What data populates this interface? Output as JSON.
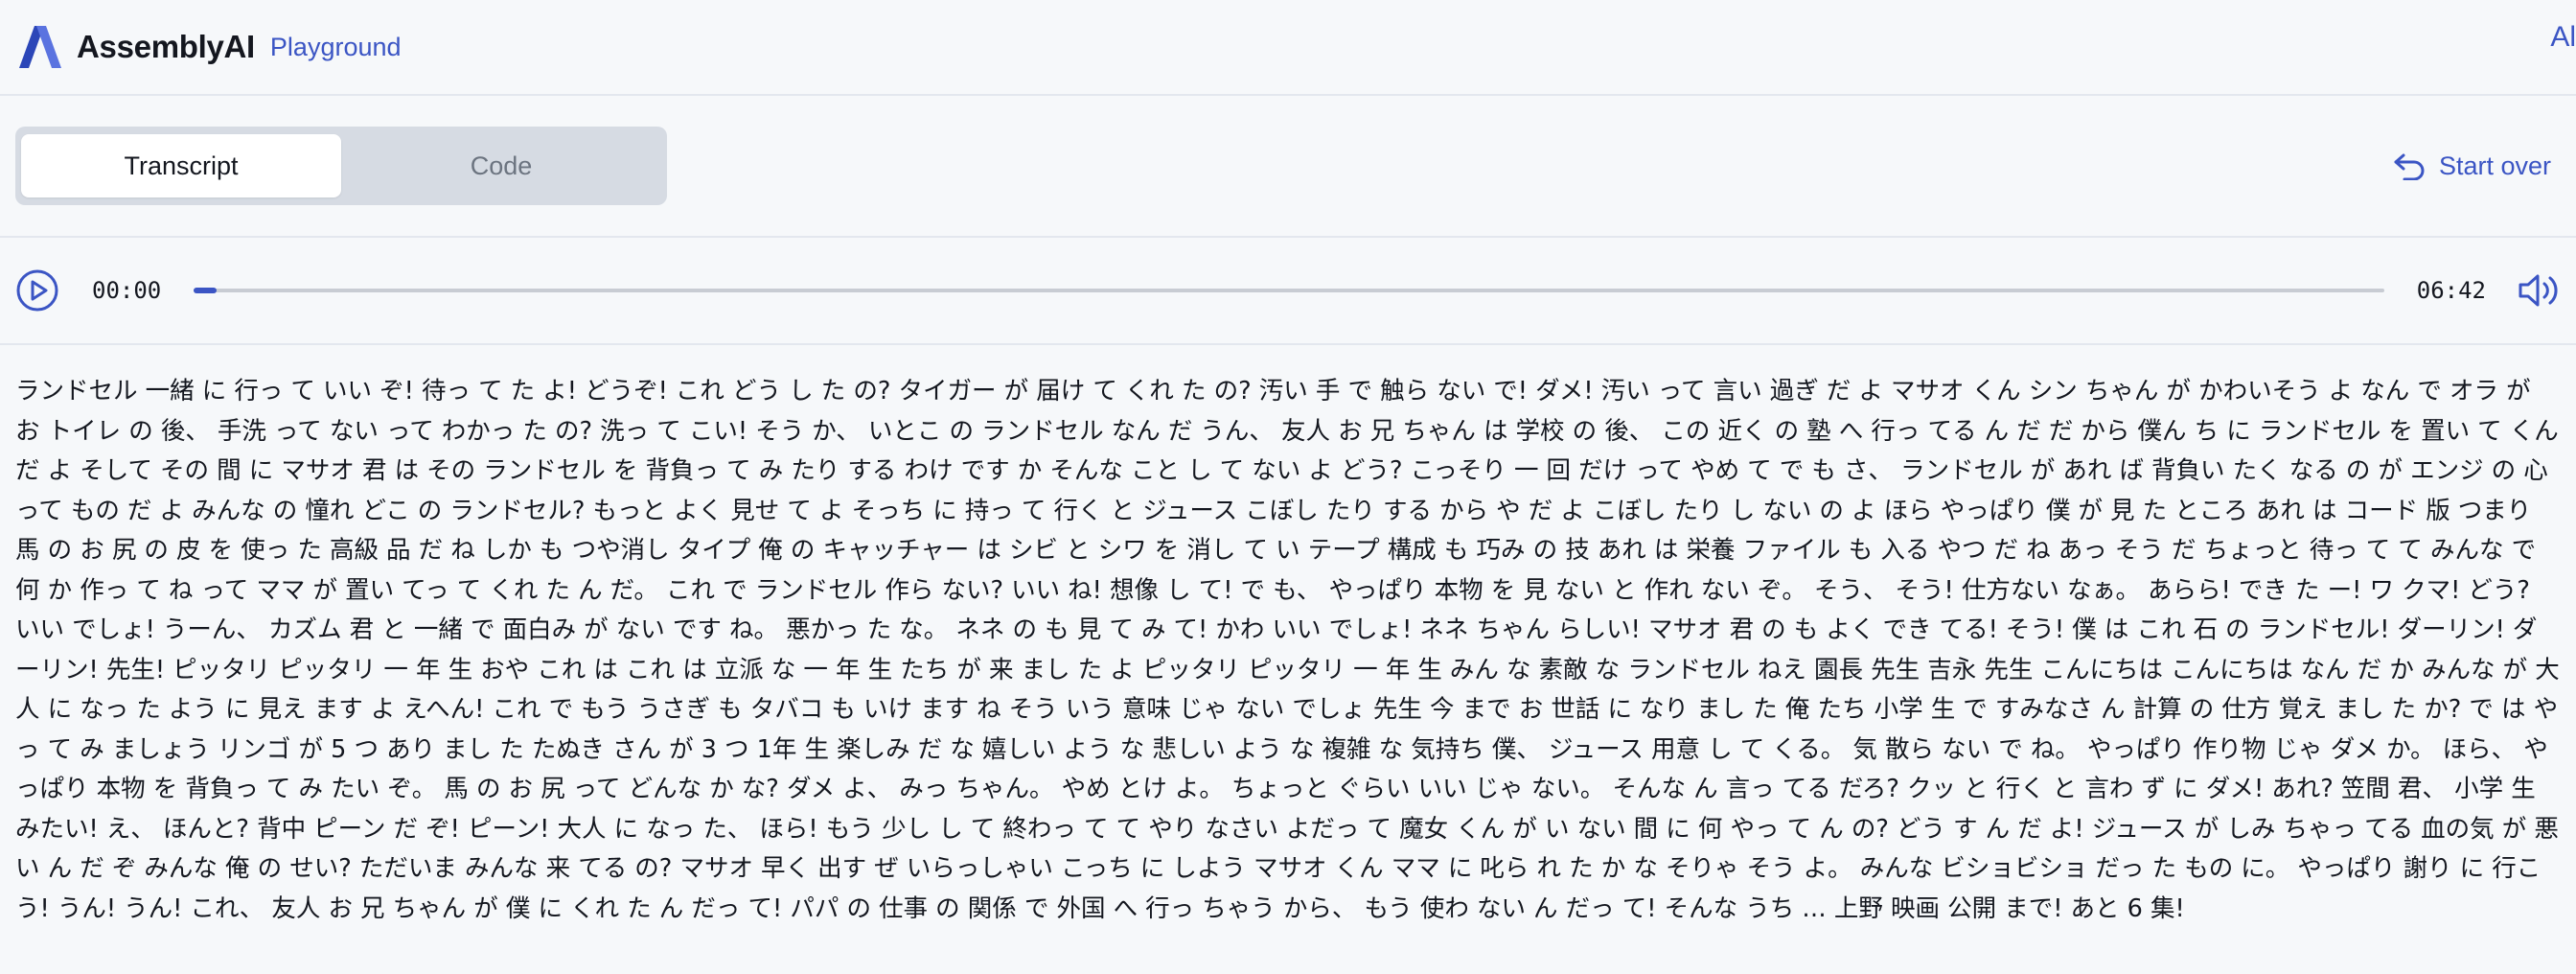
{
  "header": {
    "logo_icon": "assemblyai-logo-icon",
    "brand": "AssemblyAI",
    "product": "Playground",
    "right_partial": "Al"
  },
  "tabs": [
    {
      "label": "Transcript",
      "active": true
    },
    {
      "label": "Code",
      "active": false
    }
  ],
  "start_over": {
    "label": "Start over",
    "icon": "undo-arrow-icon"
  },
  "player": {
    "play_icon": "play-circle-icon",
    "current_time": "00:00",
    "duration": "06:42",
    "progress": 0.0,
    "volume_icon": "volume-icon"
  },
  "colors": {
    "accent": "#3b55c4",
    "background": "#f6f8fa",
    "tab_track": "#d6dbe3"
  },
  "transcript": {
    "text": "ランドセル 一緒 に 行っ て いい ぞ! 待っ て た よ! どうぞ! これ どう し た の? タイガー が 届け て くれ た の? 汚い 手 で 触ら ない で! ダメ! 汚い って 言い 過ぎ だ よ マサオ くん シン ちゃん が かわいそう よ なん で オラ が お トイレ の 後、 手洗 って ない って わかっ た の? 洗っ て こい! そう か、 いとこ の ランドセル なん だ うん、 友人 お 兄 ちゃん は 学校 の 後、 この 近く の 塾 へ 行っ てる ん だ だ から 僕ん ち に ランドセル を 置い て くん だ よ そして その 間 に マサオ 君 は その ランドセル を 背負っ て み たり する わけ です か そんな こと し て ない よ どう? こっそり 一 回 だけ って やめ て で も さ、 ランドセル が あれ ば 背負い たく なる の が エンジ の 心 って もの だ よ みんな の 憧れ どこ の ランドセル? もっと よく 見せ て よ そっち に 持っ て 行く と ジュース こぼし たり する から や だ よ こぼし たり し ない の よ ほら やっぱり 僕 が 見 た ところ あれ は コード 版 つまり 馬 の お 尻 の 皮 を 使っ た 高級 品 だ ね しか も つや消し タイプ 俺 の キャッチャー は シビ と シワ を 消し て い テープ 構成 も 巧み の 技 あれ は 栄養 ファイル も 入る やつ だ ね あっ そう だ ちょっと 待っ て て みんな で 何 か 作っ て ね って ママ が 置い てっ て くれ た ん だ。 これ で ランドセル 作ら ない? いい ね! 想像 し て! で も、 やっぱり 本物 を 見 ない と 作れ ない ぞ。 そう、 そう! 仕方ない なぁ。 あらら! でき た ー! ワ クマ! どう? いい でしょ! うーん、 カズム 君 と 一緒 で 面白み が ない です ね。 悪かっ た な。 ネネ の も 見 て み て! かわ いい でしょ! ネネ ちゃん らしい! マサオ 君 の も よく でき てる! そう! 僕 は これ 石 の ランドセル! ダーリン! ダーリン! 先生! ピッタリ ピッタリ 一 年 生 おや これ は これ は 立派 な 一 年 生 たち が 来 まし た よ ピッタリ ピッタリ 一 年 生 みん な 素敵 な ランドセル ねえ 園長 先生 吉永 先生 こんにちは こんにちは なん だ か みんな が 大人 に なっ た よう に 見え ます よ えへん! これ で もう うさぎ も タバコ も いけ ます ね そう いう 意味 じゃ ない でしょ 先生 今 まで お 世話 に なり まし た 俺 たち 小学 生 で すみなさ ん 計算 の 仕方 覚え まし た か? で は やっ て み ましょう リンゴ が 5 つ あり まし た たぬき さん が 3 つ 1年 生 楽しみ だ な 嬉しい よう な 悲しい よう な 複雑 な 気持ち 僕、 ジュース 用意 し て くる。 気 散ら ない で ね。 やっぱり 作り物 じゃ ダメ か。 ほら、 やっぱり 本物 を 背負っ て み たい ぞ。 馬 の お 尻 って どんな か な? ダメ よ、 みっ ちゃん。 やめ とけ よ。 ちょっと ぐらい いい じゃ ない。 そんな ん 言っ てる だろ? クッ と 行く と 言わ ず に ダメ! あれ? 笠間 君、 小学 生 みたい! え、 ほんと? 背中 ピーン だ ぞ! ピーン! 大人 に なっ た、 ほら! もう 少し し て 終わっ て て やり なさい よだっ て 魔女 くん が い ない 間 に 何 やっ て ん の? どう す ん だ よ! ジュース が しみ ちゃっ てる 血の気 が 悪い ん だ ぞ みんな 俺 の せい? ただいま みんな 来 てる の? マサオ 早く 出す ぜ いらっしゃい こっち に しよう マサオ くん ママ に 叱ら れ た か な そりゃ そう よ。 みんな ビショビショ だっ た もの に。 やっぱり 謝り に 行こう! うん! うん! これ、 友人 お 兄 ちゃん が 僕 に くれ た ん だっ て! パパ の 仕事 の 関係 で 外国 へ 行っ ちゃう から、 もう 使わ ない ん だっ て! そんな うち … 上野 映画 公開 まで! あと 6 集!"
  }
}
